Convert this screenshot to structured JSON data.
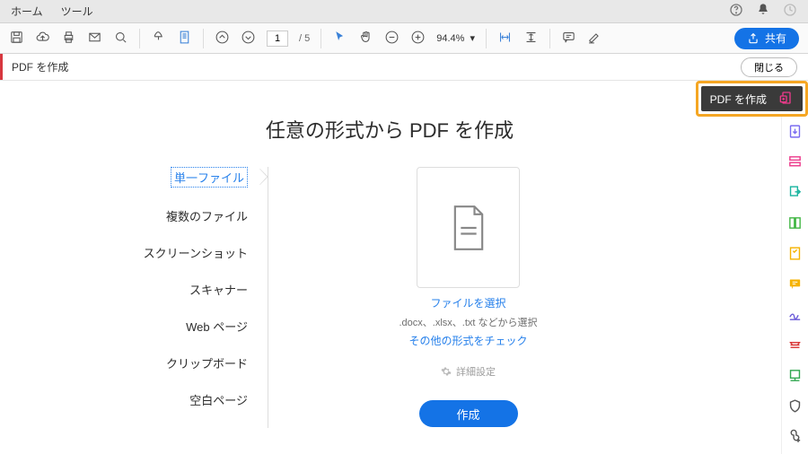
{
  "menubar": {
    "home": "ホーム",
    "tools": "ツール"
  },
  "toolbar": {
    "page_current": "1",
    "page_total": "/ 5",
    "zoom": "94.4%",
    "share": "共有"
  },
  "subheader": {
    "title": "PDF を作成",
    "close": "閉じる"
  },
  "callout": {
    "label": "PDF を作成"
  },
  "main": {
    "title": "任意の形式から PDF を作成",
    "sidelist": {
      "single_file": "単一ファイル",
      "multiple_files": "複数のファイル",
      "screenshot": "スクリーンショット",
      "scanner": "スキャナー",
      "webpage": "Web ページ",
      "clipboard": "クリップボード",
      "blank": "空白ページ"
    },
    "content": {
      "select_file": "ファイルを選択",
      "hint": ".docx、.xlsx、.txt などから選択",
      "other_formats": "その他の形式をチェック",
      "advanced": "詳細設定",
      "create": "作成"
    }
  }
}
